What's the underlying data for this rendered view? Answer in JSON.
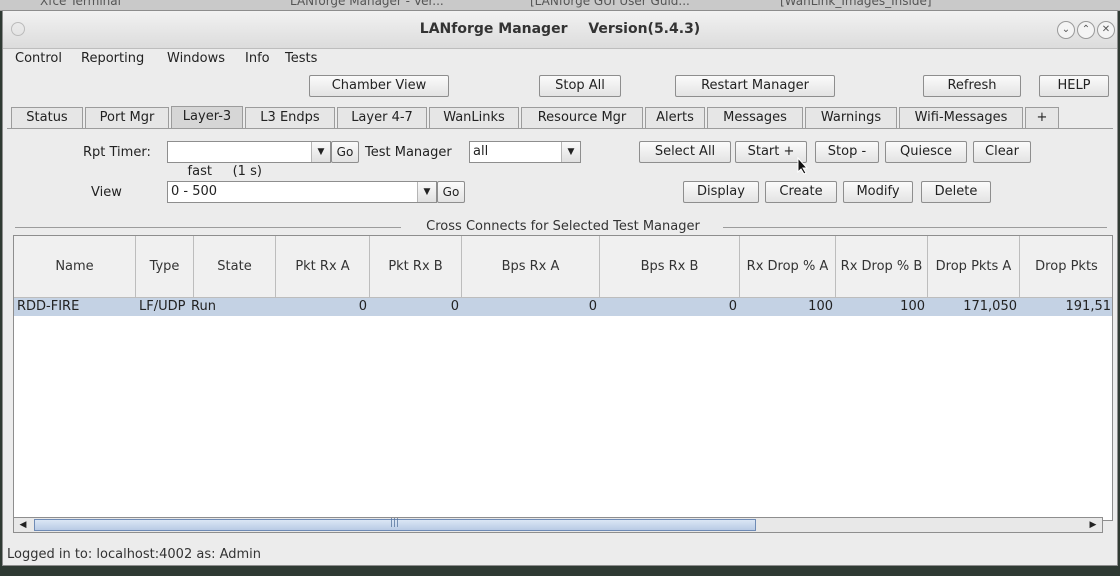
{
  "window": {
    "app_title": "LANforge Manager",
    "version": "Version(5.4.3)"
  },
  "taskbar": [
    "Xfce Terminal",
    "LANforge Manager - Ver...",
    "[LANforge GUI User Guid...",
    "[WanLink_Images_Inside]"
  ],
  "menu": [
    "Control",
    "Reporting",
    "Windows",
    "Info",
    "Tests"
  ],
  "toolbar": {
    "chamber_view": "Chamber View",
    "stop_all": "Stop All",
    "restart_manager": "Restart Manager",
    "refresh": "Refresh",
    "help": "HELP"
  },
  "tabs": [
    "Status",
    "Port Mgr",
    "Layer-3",
    "L3 Endps",
    "Layer 4-7",
    "WanLinks",
    "Resource Mgr",
    "Alerts",
    "Messages",
    "Warnings",
    "Wifi-Messages",
    "+"
  ],
  "controls": {
    "rpt_timer_label": "Rpt Timer:",
    "rpt_timer_value": "fast     (1 s)",
    "go": "Go",
    "test_manager_label": "Test Manager",
    "test_manager_value": "all",
    "view_label": "View",
    "view_value": "0 - 500",
    "select_all": "Select All",
    "start": "Start +",
    "stop": "Stop -",
    "quiesce": "Quiesce",
    "clear": "Clear",
    "display": "Display",
    "create": "Create",
    "modify": "Modify",
    "delete": "Delete"
  },
  "section_title": "Cross Connects for Selected Test Manager",
  "table": {
    "columns": [
      "Name",
      "Type",
      "State",
      "Pkt Rx A",
      "Pkt Rx B",
      "Bps Rx A",
      "Bps Rx B",
      "Rx Drop % A",
      "Rx Drop % B",
      "Drop Pkts A",
      "Drop Pkts"
    ],
    "rows": [
      [
        "RDD-FIRE",
        "LF/UDP",
        "Run",
        "0",
        "0",
        "0",
        "0",
        "100",
        "100",
        "171,050",
        "191,51"
      ]
    ]
  },
  "status": "Logged in to:  localhost:4002  as:  Admin"
}
